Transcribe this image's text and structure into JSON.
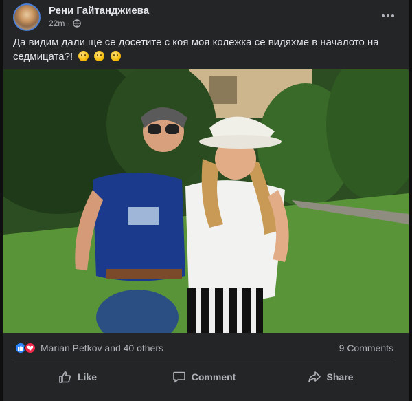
{
  "post": {
    "author": "Рени Гайтанджиева",
    "time": "22m",
    "separator": "·",
    "privacy_icon": "globe-icon",
    "caption": "Да видим дали ще се досетите с коя моя колежка се видяхме в началото на седмицата?!",
    "caption_emojis": [
      "smile-emoji",
      "smile-emoji",
      "smile-emoji"
    ]
  },
  "engagement": {
    "reactions_text": "Marian Petkov and 40 others",
    "reaction_icons": [
      "like-reaction-icon",
      "love-reaction-icon"
    ],
    "comments_text": "9 Comments"
  },
  "actions": {
    "like_label": "Like",
    "comment_label": "Comment",
    "share_label": "Share"
  },
  "colors": {
    "card_bg": "#242526",
    "text_primary": "#e4e6eb",
    "text_secondary": "#b0b3b8",
    "like_blue": "#2d86ff",
    "love_red": "#f02849"
  }
}
